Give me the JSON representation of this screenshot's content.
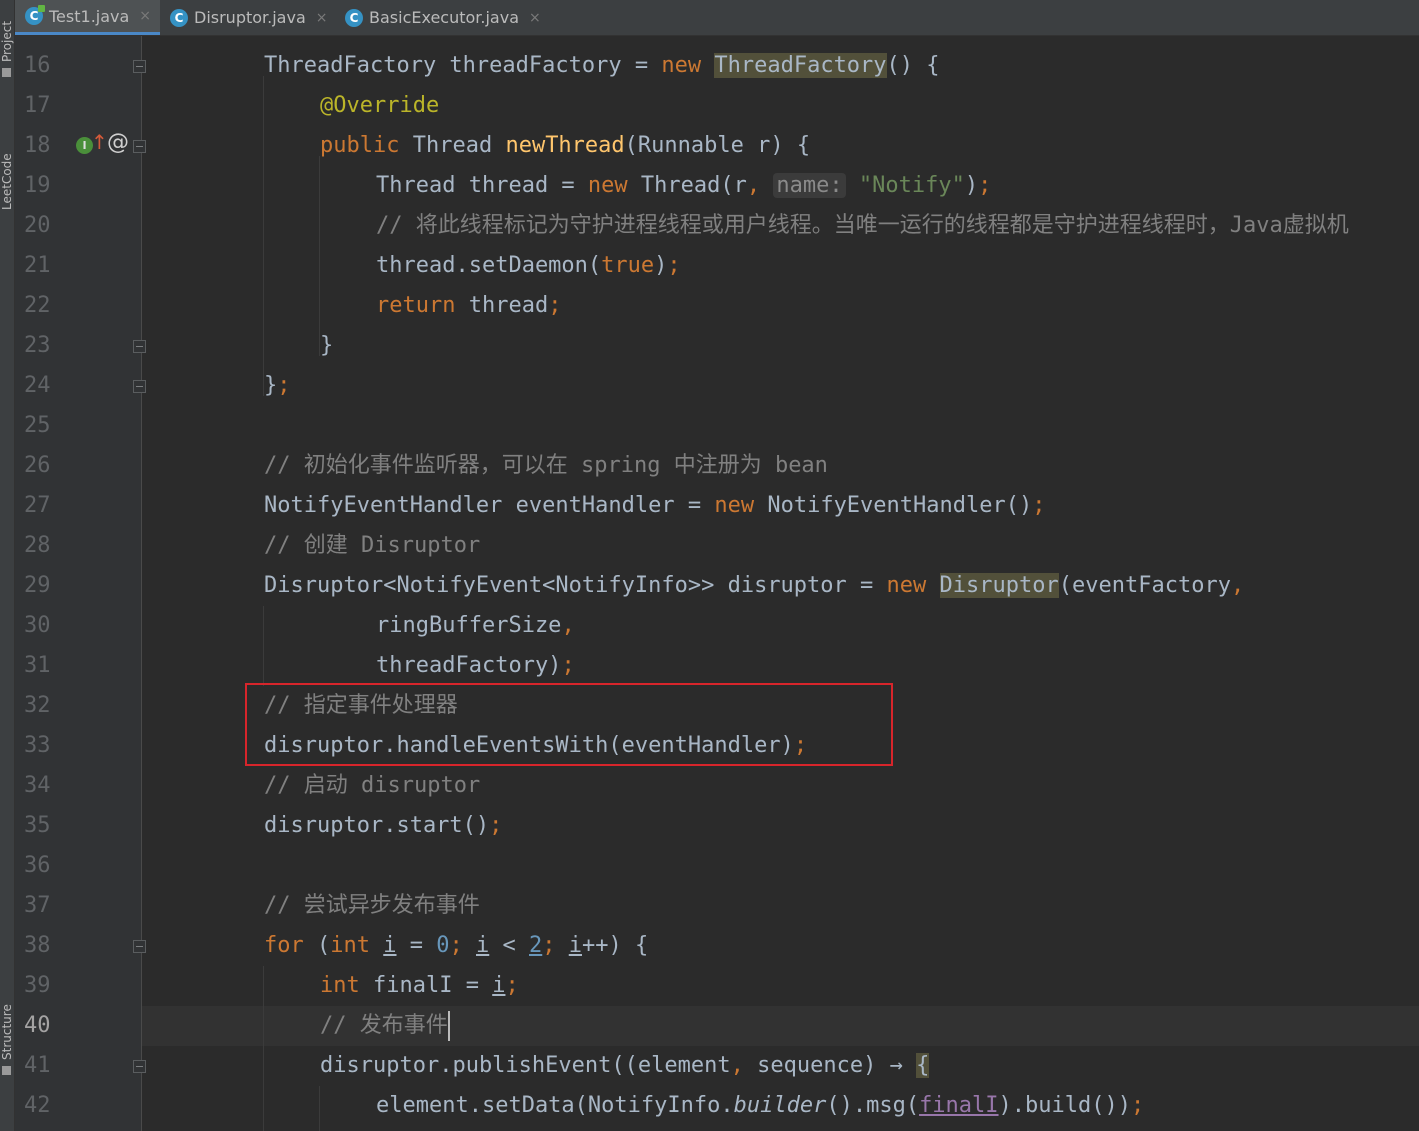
{
  "sidebar": {
    "project_label": "Project",
    "leetcode_label": "LeetCode",
    "structure_label": "Structure"
  },
  "tabs": [
    {
      "label": "Test1.java",
      "close": "×",
      "icon": "java-class-icon"
    },
    {
      "label": "Disruptor.java",
      "close": "×",
      "icon": "java-class-icon"
    },
    {
      "label": "BasicExecutor.java",
      "close": "×",
      "icon": "java-class-icon"
    }
  ],
  "line_numbers": [
    "16",
    "17",
    "18",
    "19",
    "20",
    "21",
    "22",
    "23",
    "24",
    "25",
    "26",
    "27",
    "28",
    "29",
    "30",
    "31",
    "32",
    "33",
    "34",
    "35",
    "36",
    "37",
    "38",
    "39",
    "40",
    "41",
    "42"
  ],
  "code": {
    "l16": [
      "ThreadFactory threadFactory = ",
      "new",
      " ",
      "ThreadFactory",
      "() {"
    ],
    "l17": [
      "@Override"
    ],
    "l18": [
      "public",
      " Thread ",
      "newThread",
      "(Runnable r) {"
    ],
    "l19": [
      "Thread thread = ",
      "new",
      " Thread(r",
      ",",
      " ",
      "name:",
      " ",
      "\"Notify\"",
      ")",
      ";"
    ],
    "l20": [
      "// 将此线程标记为守护进程线程或用户线程。当唯一运行的线程都是守护进程线程时，Java虚拟机"
    ],
    "l21": [
      "thread.setDaemon(",
      "true",
      ")",
      ";"
    ],
    "l22": [
      "return",
      " thread",
      ";"
    ],
    "l23": [
      "}"
    ],
    "l24": [
      "}",
      ";"
    ],
    "l26": [
      "// 初始化事件监听器，可以在 spring 中注册为 bean"
    ],
    "l27": [
      "NotifyEventHandler eventHandler = ",
      "new",
      " NotifyEventHandler()",
      ";"
    ],
    "l28": [
      "// 创建 Disruptor"
    ],
    "l29": [
      "Disruptor<NotifyEvent<NotifyInfo>> disruptor = ",
      "new",
      " ",
      "Disruptor",
      "(eventFactory",
      ","
    ],
    "l30": [
      "ringBufferSize",
      ","
    ],
    "l31": [
      "threadFactory)",
      ";"
    ],
    "l32": [
      "// 指定事件处理器"
    ],
    "l33": [
      "disruptor.handleEventsWith(eventHandler)",
      ";"
    ],
    "l34": [
      "// 启动 disruptor"
    ],
    "l35": [
      "disruptor.start()",
      ";"
    ],
    "l37": [
      "// 尝试异步发布事件"
    ],
    "l38": [
      "for",
      " (",
      "int",
      " ",
      "i",
      " = ",
      "0",
      "; ",
      "i",
      " < ",
      "2",
      "; ",
      "i",
      "++) {"
    ],
    "l39": [
      "int",
      " finalI = ",
      "i",
      ";"
    ],
    "l40": [
      "// 发布事件"
    ],
    "l41": [
      "disruptor.publishEvent((element",
      ",",
      " sequence) ",
      "→",
      " ",
      "{"
    ],
    "l42": [
      "element.setData(NotifyInfo.",
      "builder",
      "().msg(",
      "finalI",
      ").build())",
      ";"
    ]
  }
}
